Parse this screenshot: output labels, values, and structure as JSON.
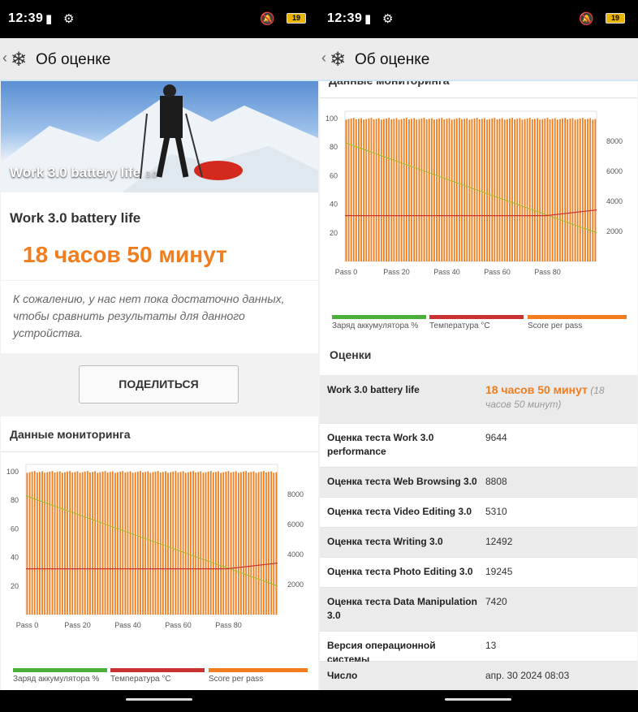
{
  "status": {
    "time": "12:39",
    "battery": "19"
  },
  "appbar": {
    "title": "Об оценке"
  },
  "hero": {
    "title": "Work 3.0 battery life",
    "version": "3.0"
  },
  "summary": {
    "test_name": "Work 3.0 battery life",
    "result": "18 часов 50 минут",
    "no_data_message": "К сожалению, у нас нет пока достаточно данных, чтобы сравнить результаты для данного устройства."
  },
  "share_button": "ПОДЕЛИТЬСЯ",
  "monitoring": {
    "title": "Данные мониторинга"
  },
  "legend": [
    {
      "label": "Заряд аккумулятора %",
      "color": "#4caf3a"
    },
    {
      "label": "Температура °C",
      "color": "#c83232"
    },
    {
      "label": "Score per pass",
      "color": "#f07d1e"
    }
  ],
  "chart_data": {
    "type": "bar",
    "left_axis": {
      "ticks": [
        "20",
        "40",
        "60",
        "80",
        "100"
      ],
      "range": [
        0,
        105
      ]
    },
    "right_axis": {
      "ticks": [
        "2000",
        "4000",
        "6000",
        "8000"
      ],
      "range": [
        0,
        10000
      ]
    },
    "x_ticks": [
      "Pass 0",
      "Pass 20",
      "Pass 40",
      "Pass 60",
      "Pass 80"
    ],
    "pass_count": 100,
    "series": [
      {
        "name": "Score per pass",
        "axis": "right",
        "approx_value": 9500
      },
      {
        "name": "Заряд аккумулятора %",
        "axis": "left",
        "start": 83,
        "end": 20
      },
      {
        "name": "Температура °C",
        "axis": "left",
        "start": 32,
        "end": 36
      }
    ]
  },
  "scores": {
    "title": "Оценки",
    "rows": [
      {
        "key": "Work 3.0 battery life",
        "value": "18 часов 50 минут",
        "note": "(18 часов 50 минут)"
      },
      {
        "key": "Оценка теста Work 3.0 performance",
        "value": "9644"
      },
      {
        "key": "Оценка теста Web Browsing 3.0",
        "value": "8808"
      },
      {
        "key": "Оценка теста Video Editing 3.0",
        "value": "5310"
      },
      {
        "key": "Оценка теста Writing 3.0",
        "value": "12492"
      },
      {
        "key": "Оценка теста Photo Editing 3.0",
        "value": "19245"
      },
      {
        "key": "Оценка теста Data Manipulation 3.0",
        "value": "7420"
      },
      {
        "key": "Версия операционной системы",
        "value": "13"
      },
      {
        "key": "Число",
        "value": "апр. 30 2024 08:03"
      }
    ]
  }
}
